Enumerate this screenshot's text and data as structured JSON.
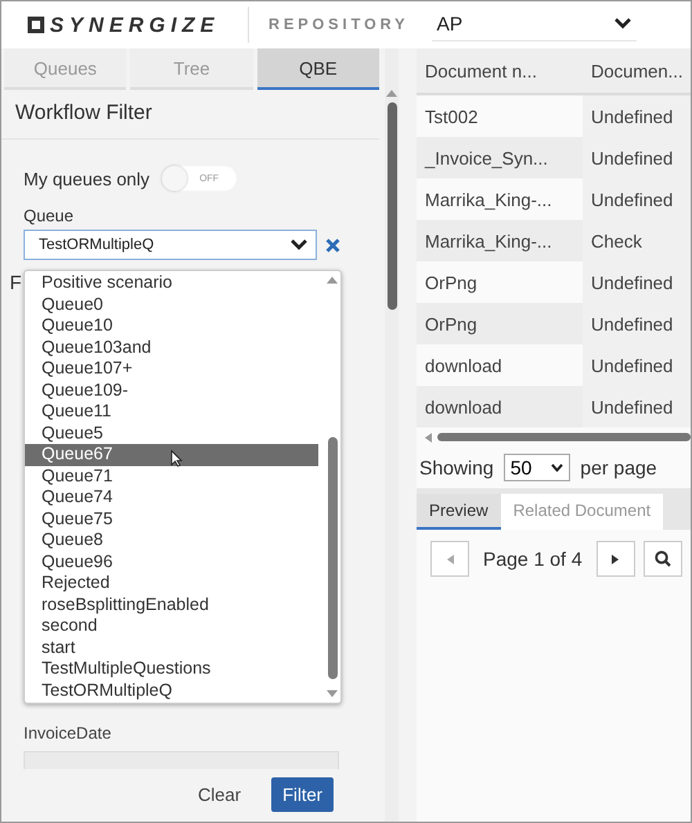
{
  "header": {
    "logo": "SYNERGIZE",
    "repository_label": "REPOSITORY",
    "repository": "AP"
  },
  "left_tabs": [
    {
      "label": "Queues",
      "selected": false
    },
    {
      "label": "Tree",
      "selected": false
    },
    {
      "label": "QBE",
      "selected": true
    }
  ],
  "filter": {
    "title": "Workflow Filter",
    "toggle": {
      "label": "My queues only",
      "on": false,
      "state_text": "OFF"
    },
    "queue_label": "Queue",
    "queue_value": "TestORMultipleQ",
    "covered_label": "F",
    "dropdown": [
      {
        "label": "Positive scenario",
        "selected": false
      },
      {
        "label": "Queue0",
        "selected": false
      },
      {
        "label": "Queue10",
        "selected": false
      },
      {
        "label": "Queue103and",
        "selected": false
      },
      {
        "label": "Queue107+",
        "selected": false
      },
      {
        "label": "Queue109-",
        "selected": false
      },
      {
        "label": "Queue11",
        "selected": false
      },
      {
        "label": "Queue5",
        "selected": false
      },
      {
        "label": "Queue67",
        "selected": true
      },
      {
        "label": "Queue71",
        "selected": false
      },
      {
        "label": "Queue74",
        "selected": false
      },
      {
        "label": "Queue75",
        "selected": false
      },
      {
        "label": "Queue8",
        "selected": false
      },
      {
        "label": "Queue96",
        "selected": false
      },
      {
        "label": "Rejected",
        "selected": false
      },
      {
        "label": "roseBsplittingEnabled",
        "selected": false
      },
      {
        "label": "second",
        "selected": false
      },
      {
        "label": "start",
        "selected": false
      },
      {
        "label": "TestMultipleQuestions",
        "selected": false
      },
      {
        "label": "TestORMultipleQ",
        "selected": false
      }
    ],
    "invoice_date_label": "InvoiceDate",
    "buttons": [
      {
        "label": "Clear",
        "kind": "plain"
      },
      {
        "label": "Filter",
        "kind": "primary"
      }
    ]
  },
  "table": {
    "columns": [
      "Document n...",
      "Documen..."
    ],
    "rows": [
      [
        "Tst002",
        "Undefined"
      ],
      [
        "_Invoice_Syn...",
        "Undefined"
      ],
      [
        "Marrika_King-...",
        "Undefined"
      ],
      [
        "Marrika_King-...",
        "Check"
      ],
      [
        "OrPng",
        "Undefined"
      ],
      [
        "OrPng",
        "Undefined"
      ],
      [
        "download",
        "Undefined"
      ],
      [
        "download",
        "Undefined"
      ]
    ]
  },
  "pagination": {
    "showing_label": "Showing",
    "page_size": "50",
    "per_page_label": "per page"
  },
  "bottom_tabs": [
    {
      "label": "Preview",
      "selected": true
    },
    {
      "label": "Related Document",
      "selected": false
    }
  ],
  "pager": {
    "page_text": "Page 1 of 4"
  }
}
